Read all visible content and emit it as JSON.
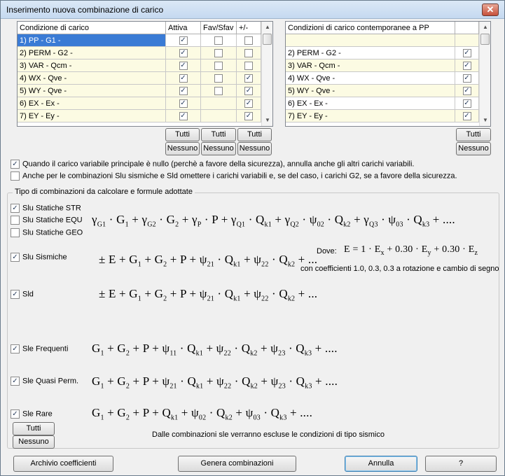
{
  "window": {
    "title": "Inserimento nuova combinazione di carico",
    "close_glyph": "✕"
  },
  "grid1": {
    "headers": [
      "Condizione di carico",
      "Attiva",
      "Fav/Sfav",
      "+/-"
    ],
    "rows": [
      {
        "label": "1) PP - G1 -",
        "attiva": true,
        "fav": false,
        "pm": false
      },
      {
        "label": "2) PERM - G2 -",
        "attiva": true,
        "fav": false,
        "pm": false
      },
      {
        "label": "3) VAR - Qcm -",
        "attiva": true,
        "fav": false,
        "pm": false
      },
      {
        "label": "4) WX - Qve -",
        "attiva": true,
        "fav": false,
        "pm": true
      },
      {
        "label": "5) WY - Qve -",
        "attiva": true,
        "fav": false,
        "pm": true
      },
      {
        "label": "6) EX - Ex -",
        "attiva": true,
        "fav": null,
        "pm": true
      },
      {
        "label": "7) EY - Ey -",
        "attiva": true,
        "fav": null,
        "pm": true
      }
    ]
  },
  "grid2": {
    "headers": [
      "Condizioni di carico contemporanee a PP",
      ""
    ],
    "rows": [
      {
        "label": "",
        "checked": null
      },
      {
        "label": "2) PERM - G2 -",
        "checked": true
      },
      {
        "label": "3) VAR - Qcm -",
        "checked": true
      },
      {
        "label": "4) WX - Qve -",
        "checked": true
      },
      {
        "label": "5) WY - Qve -",
        "checked": true
      },
      {
        "label": "6) EX - Ex -",
        "checked": true
      },
      {
        "label": "7) EY - Ey -",
        "checked": true
      }
    ]
  },
  "buttons": {
    "tutti": "Tutti",
    "nessuno": "Nessuno"
  },
  "options": {
    "opt1": "Quando il carico variabile principale è nullo (perchè a favore della sicurezza), annulla anche gli altri carichi variabili.",
    "opt2": "Anche per le combinazioni Slu sismiche e Sld omettere i carichi variabili e, se del caso, i carichi G2, se a favore della sicurezza."
  },
  "group_title": "Tipo di combinazioni da calcolare e formule adottate",
  "combos": {
    "slu_str": "Slu Statiche STR",
    "slu_equ": "Slu Statiche EQU",
    "slu_geo": "Slu Statiche GEO",
    "slu_sism": "Slu Sismiche",
    "sld": "Sld",
    "sle_freq": "Sle Frequenti",
    "sle_qp": "Sle Quasi Perm.",
    "sle_rare": "Sle Rare"
  },
  "notes": {
    "dove": "Dove:",
    "coeff": "con coefficienti 1.0, 0.3, 0.3 a rotazione e cambio di segno",
    "sle_excl": "Dalle combinazioni sle verranno escluse le condizioni di tipo sismico"
  },
  "footer": {
    "archivio": "Archivio coefficienti",
    "genera": "Genera combinazioni",
    "annulla": "Annulla",
    "help": "?"
  }
}
